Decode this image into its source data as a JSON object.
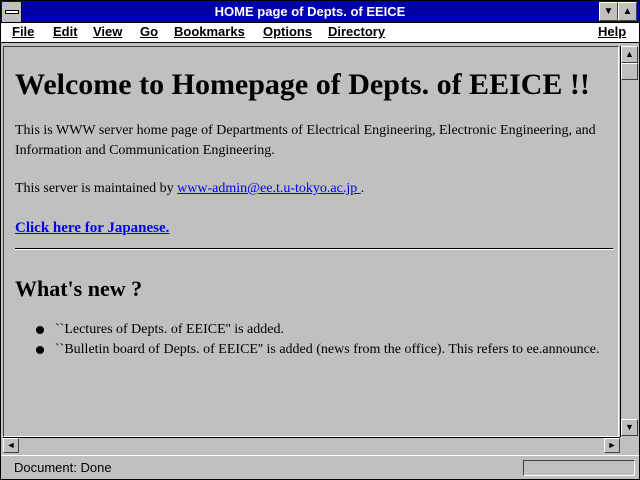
{
  "window": {
    "title": "HOME page of Depts. of EEICE"
  },
  "menu": {
    "items": [
      "File",
      "Edit",
      "View",
      "Go",
      "Bookmarks",
      "Options",
      "Directory"
    ],
    "help": "Help"
  },
  "document": {
    "heading": "Welcome to Homepage of Depts. of EEICE !!",
    "intro": "This is WWW server home page of Departments of Electrical Engineering, Electronic Engineering, and Information and Communication Engineering.",
    "maintained_prefix": "This server is maintained by ",
    "maintainer_email": "www-admin@ee.t.u-tokyo.ac.jp ",
    "maintained_suffix": ".",
    "japanese_link": "Click here for Japanese.",
    "whats_new_heading": "What's new ?",
    "whats_new_items": [
      "``Lectures of Depts. of EEICE'' is added.",
      "``Bulletin board of Depts. of EEICE'' is added (news from the office). This refers to ee.announce."
    ]
  },
  "status": {
    "text": "Document: Done"
  },
  "icons": {
    "system_menu": "system-menu-icon",
    "minimize": "minimize-arrow-icon",
    "maximize": "maximize-arrow-icon",
    "scroll_up": "arrow-up-icon",
    "scroll_down": "arrow-down-icon",
    "scroll_left": "arrow-left-icon",
    "scroll_right": "arrow-right-icon"
  },
  "colors": {
    "title_bar": "#0000a8",
    "link": "#0000ee",
    "background": "#c0c0c0"
  }
}
